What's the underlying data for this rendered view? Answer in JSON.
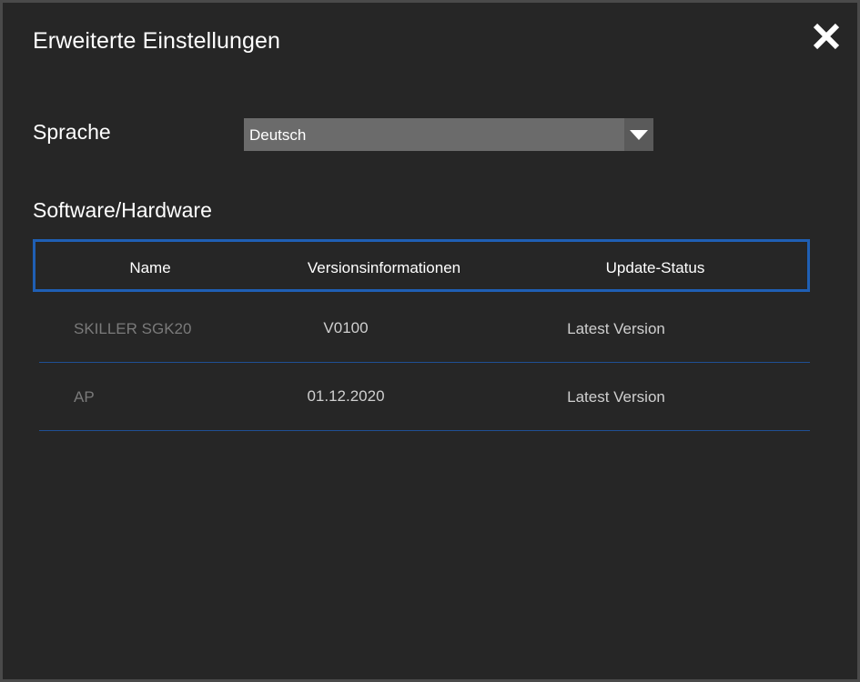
{
  "dialog": {
    "title": "Erweiterte Einstellungen",
    "close_label": "X"
  },
  "language": {
    "label": "Sprache",
    "selected": "Deutsch"
  },
  "software_hardware": {
    "title": "Software/Hardware",
    "columns": [
      "Name",
      "Versionsinformationen",
      "Update-Status"
    ],
    "rows": [
      {
        "name": "SKILLER SGK20",
        "version": "V0100",
        "status": "Latest Version"
      },
      {
        "name": "AP",
        "version": "01.12.2020",
        "status": "Latest Version"
      }
    ]
  },
  "colors": {
    "background": "#262626",
    "accent_blue": "#1f5fb4",
    "select_bg": "#6b6b6b"
  },
  "icons": {
    "close": "close-icon",
    "dropdown": "chevron-down-icon"
  }
}
